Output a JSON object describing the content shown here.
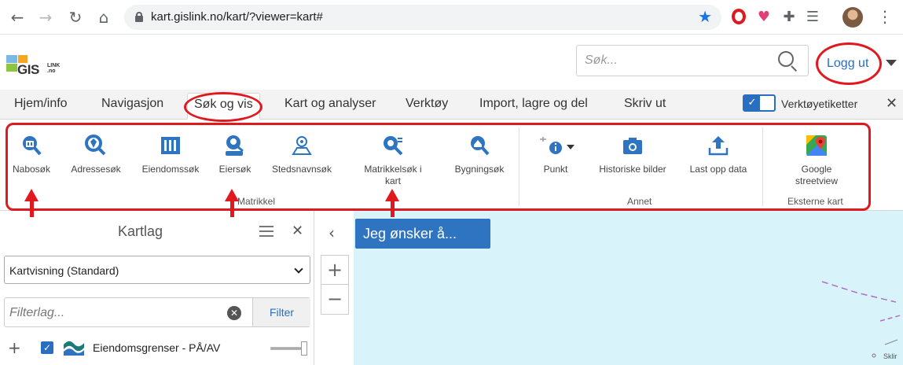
{
  "browser": {
    "url": "kart.gislink.no/kart/?viewer=kart#",
    "back_glyph": "←",
    "forward_glyph": "→",
    "reload_glyph": "↻",
    "home_glyph": "⌂",
    "star_glyph": "★",
    "shield_glyph": "♥",
    "puzzle_glyph": "✚",
    "playlist_glyph": "☰",
    "menu_glyph": "⋮"
  },
  "header": {
    "logo_text": "GIS",
    "logo_sub": "LINK .no",
    "search_placeholder": "Søk...",
    "logout_label": "Logg ut"
  },
  "tabs": {
    "items": [
      "Hjem/info",
      "Navigasjon",
      "Søk og vis",
      "Kart og analyser",
      "Verktøy",
      "Import, lagre og del",
      "Skriv ut"
    ],
    "active": "Søk og vis",
    "toggle_glyph": "✓",
    "toggle_label": "Verktøyetiketter",
    "close_glyph": "✕"
  },
  "ribbon": {
    "matrikkel": {
      "label": "Matrikkel",
      "tools": [
        "Nabosøk",
        "Adressesøk",
        "Eiendomssøk",
        "Eiersøk",
        "Stedsnavnsøk",
        "Matrikkelsøk i kart",
        "Bygningsøk"
      ]
    },
    "annet": {
      "label": "Annet",
      "tools": [
        "Punkt",
        "Historiske bilder",
        "Last opp data"
      ]
    },
    "eksterne": {
      "label": "Eksterne kart",
      "tools": [
        "Google streetview"
      ]
    }
  },
  "panel": {
    "title": "Kartlag",
    "close_glyph": "✕",
    "select_value": "Kartvisning (Standard)",
    "filter_placeholder": "Filterlag...",
    "clear_glyph": "✕",
    "filter_label": "Filter",
    "expand_glyph": "+",
    "check_glyph": "✓",
    "layer_name": "Eiendomsgrenser - PÅ/AV",
    "layer_opacity": 1.0
  },
  "map": {
    "collapse_glyph": "‹",
    "wish_button": "Jeg ønsker å...",
    "zoom_in": "+",
    "zoom_out": "−",
    "corner_text": "Sklir"
  },
  "colors": {
    "accent": "#2f74c0",
    "annotation": "#e0191f",
    "map_water": "#d9f3fb",
    "icon_blue": "#2a6fbf"
  }
}
